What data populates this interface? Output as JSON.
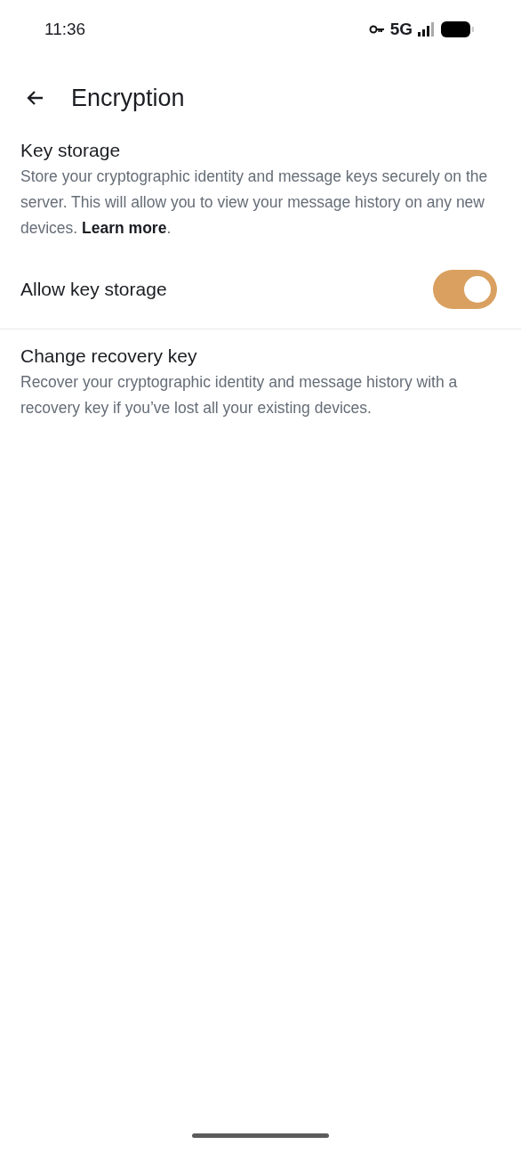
{
  "status_bar": {
    "time": "11:36",
    "network": "5G"
  },
  "app_bar": {
    "title": "Encryption"
  },
  "sections": [
    {
      "kind": "info",
      "title": "Key storage",
      "description": "Store your cryptographic identity and message keys securely on the server. This will allow you to view your message history on any new devices.",
      "link": "Learn more",
      "after_link": "."
    },
    {
      "kind": "switch",
      "label": "Allow key storage",
      "on": true
    },
    {
      "kind": "divider"
    },
    {
      "kind": "action",
      "title": "Change recovery key",
      "description": "Recover your cryptographic identity and message history with a recovery key if you’ve lost all your existing devices."
    }
  ]
}
